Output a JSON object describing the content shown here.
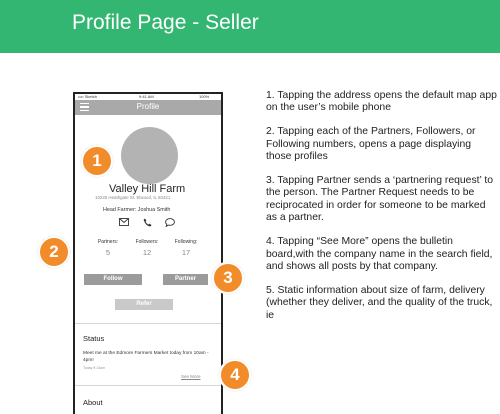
{
  "banner": {
    "title": "Profile Page - Seller",
    "color": "#34b673"
  },
  "phone": {
    "status_bar": {
      "carrier": "•••• Sketch",
      "time": "9:41 AM",
      "battery": "100%"
    },
    "nav": {
      "title": "Profile",
      "menu_icon": "hamburger-icon"
    },
    "profile": {
      "farm_name": "Valley Hill Farm",
      "address": "10225 Heathgate St. Elwood, IL 60421",
      "head_farmer": "Head Farmer: Joshua  Smith",
      "contact_icons": [
        "mail-icon",
        "phone-icon",
        "chat-icon"
      ]
    },
    "stats": [
      {
        "label": "Partners:",
        "value": "5"
      },
      {
        "label": "Followers:",
        "value": "12"
      },
      {
        "label": "Following:",
        "value": "17"
      }
    ],
    "buttons": {
      "follow": "Follow",
      "partner": "Partner",
      "refer": "Refer"
    },
    "status": {
      "heading": "Status",
      "text": "Meet me at the Edmore Farmers Market today from 10am - 4pm!",
      "time": "Today 9:14am",
      "see_more": "See More"
    },
    "about": {
      "heading": "About"
    }
  },
  "markers": [
    "1",
    "2",
    "3",
    "4"
  ],
  "marker_color": "#f28c2b",
  "notes": [
    "1. Tapping the address opens the default map app on the user’s mobile phone",
    "2. Tapping each of the Partners, Followers, or Following numbers, opens a page displaying those profiles",
    "3. Tapping Partner sends a ‘partnering request’ to the person. The Partner Request needs to be reciprocated in order for someone to be marked as a partner.",
    "4. Tapping “See More” opens the bulletin board,with the company name in the search field, and shows all posts by that company.",
    "5. Static information about size of farm, delivery (whether they deliver, and the quality of the truck, ie"
  ]
}
